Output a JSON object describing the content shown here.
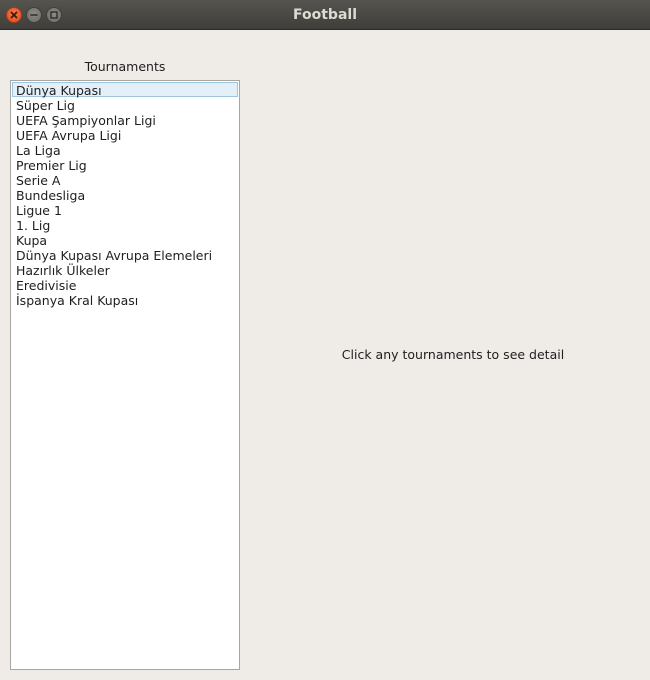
{
  "window": {
    "title": "Football",
    "controls": {
      "close_icon": "close-icon",
      "minimize_icon": "minimize-icon",
      "maximize_icon": "maximize-icon"
    }
  },
  "tournaments": {
    "label": "Tournaments",
    "selected_index": 0,
    "items": [
      "Dünya Kupası",
      "Süper Lig",
      "UEFA Şampiyonlar Ligi",
      "UEFA Avrupa Ligi",
      "La Liga",
      "Premier Lig",
      "Serie A",
      "Bundesliga",
      "Ligue 1",
      "1. Lig",
      "Kupa",
      "Dünya Kupası Avrupa Elemeleri",
      "Hazırlık Ülkeler",
      "Eredivisie",
      "İspanya Kral Kupası"
    ]
  },
  "detail": {
    "message": "Click any tournaments to see detail"
  },
  "colors": {
    "window_bg": "#efebe7",
    "titlebar": "#3f3e3a",
    "selection_bg": "#e3f0f9",
    "selection_border": "#9fc4df",
    "close_button": "#dd4a14"
  }
}
